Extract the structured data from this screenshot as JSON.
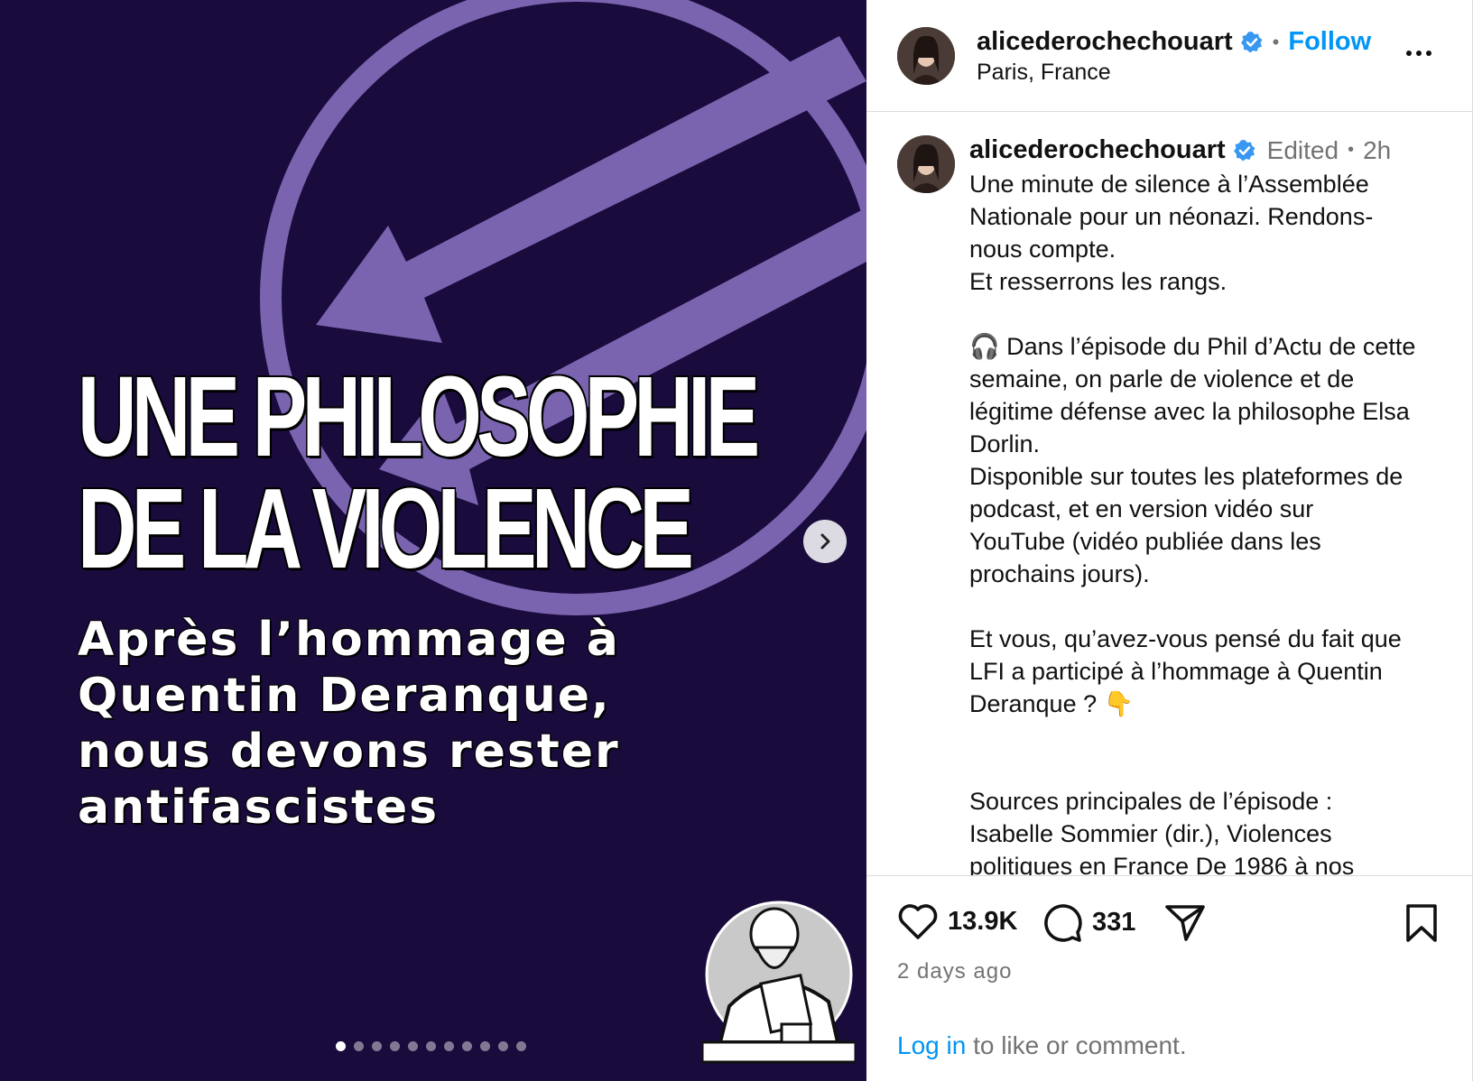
{
  "media": {
    "headline_lines": [
      "UNE PHILOSOPHIE",
      "DE LA VIOLENCE"
    ],
    "subhead_lines": [
      "Après l’hommage à",
      "Quentin Deranque,",
      "nous devons rester",
      "antifascistes"
    ],
    "next_icon": "chevron-right-icon",
    "carousel_total": 11,
    "carousel_active_index": 0,
    "colors": {
      "background": "#1a0b3d",
      "emblem": "#7a64b0"
    }
  },
  "header": {
    "username": "alicederochechouart",
    "separator": "•",
    "follow_label": "Follow",
    "location": "Paris, France",
    "more_icon": "more-options-icon"
  },
  "caption": {
    "username": "alicederochechouart",
    "edited": "Edited",
    "separator": "•",
    "age": "2h",
    "lines_a": [
      "Une minute de silence à l’Assemblée",
      "Nationale pour un néonazi. Rendons-",
      "nous compte.",
      "Et resserrons les rangs."
    ],
    "lines_b": [
      "🎧 Dans l’épisode du Phil d’Actu de cette",
      "semaine, on parle de violence et de",
      "légitime défense avec la philosophe Elsa",
      "Dorlin.",
      "Disponible sur toutes les plateformes de",
      "podcast, et en version vidéo sur",
      "YouTube (vidéo publiée dans les",
      "prochains jours)."
    ],
    "lines_c": [
      "Et vous, qu’avez-vous pensé du fait que",
      "LFI a participé à l’hommage à Quentin",
      "Deranque ? 👇"
    ],
    "lines_d": [
      "Sources principales de l’épisode :",
      "Isabelle Sommier (dir.), Violences",
      "politiques en France De 1986 à nos"
    ]
  },
  "actions": {
    "like_count": "13.9K",
    "comment_count": "331",
    "timestamp": "2 days ago",
    "login_link": "Log in",
    "login_rest": " to like or comment."
  },
  "colors": {
    "link": "#0095f6",
    "muted": "#737373",
    "divider": "#dbdbdb"
  }
}
